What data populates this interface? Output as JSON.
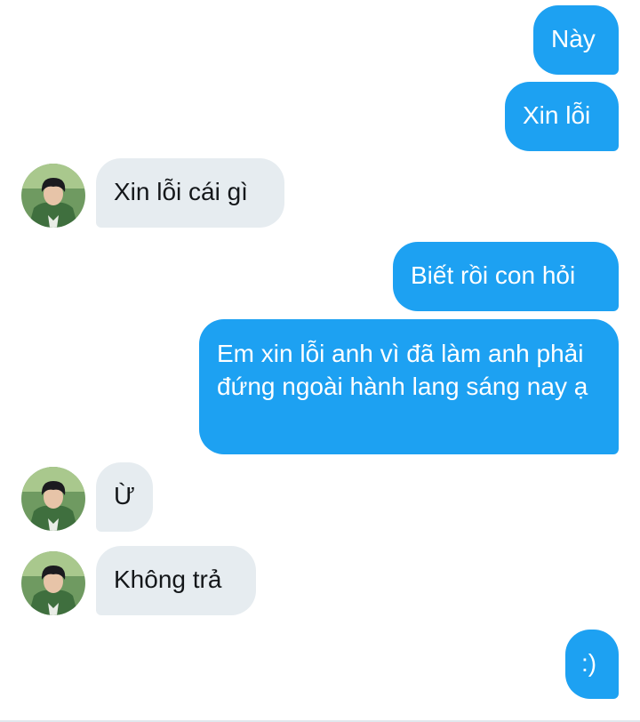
{
  "conversation": {
    "messages": [
      {
        "sender": "me",
        "text": "Này"
      },
      {
        "sender": "me",
        "text": "Xin lỗi"
      },
      {
        "sender": "other",
        "text": "Xin lỗi cái gì"
      },
      {
        "sender": "me",
        "text": "Biết rồi con hỏi"
      },
      {
        "sender": "me",
        "text": "Em xin lỗi anh vì đã làm anh phải đứng ngoài hành lang sáng nay ạ"
      },
      {
        "sender": "other",
        "text": "Ừ"
      },
      {
        "sender": "other",
        "text": "Không trả"
      },
      {
        "sender": "me",
        "text": ":)"
      }
    ]
  },
  "colors": {
    "outgoing_bubble": "#1da1f2",
    "incoming_bubble": "#e6ecf0",
    "outgoing_text": "#ffffff",
    "incoming_text": "#14171a"
  },
  "icons": {
    "contact_avatar": "profile-photo"
  }
}
